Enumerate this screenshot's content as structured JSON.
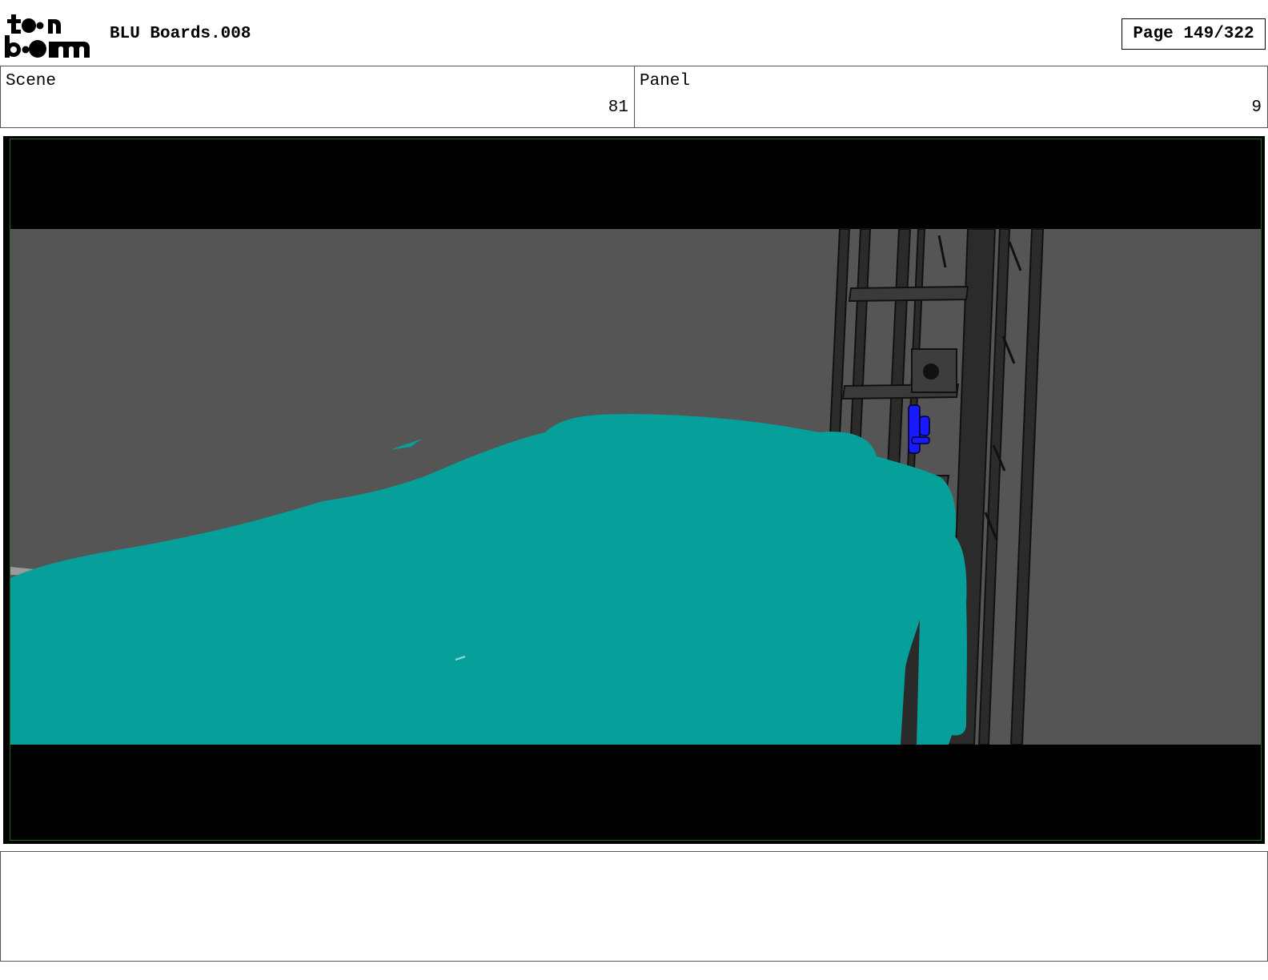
{
  "header": {
    "logo_text": "toon boom",
    "document_title": "BLU Boards.008",
    "page_label": "Page 149/322"
  },
  "info": {
    "scene_label": "Scene",
    "scene_value": "81",
    "panel_label": "Panel",
    "panel_value": "9"
  },
  "notes": {
    "text": ""
  },
  "colors": {
    "background_wall": "#555555",
    "shape_fill": "#079f9a",
    "letterbox": "#000000",
    "figure": "#1a1aff",
    "ladder": "#2b2b2b"
  }
}
